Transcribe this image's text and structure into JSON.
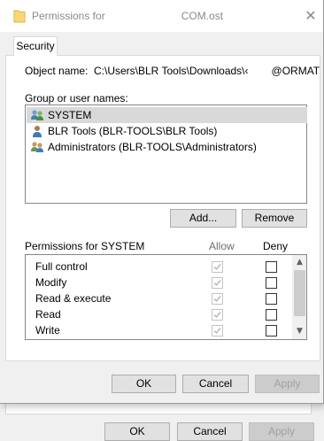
{
  "window": {
    "title_left": "Permissions for",
    "title_right": "COM.ost",
    "close_glyph": "✕"
  },
  "tab": {
    "label": "Security"
  },
  "object": {
    "label": "Object name:",
    "value_left": "C:\\Users\\BLR Tools\\Downloads\\‹",
    "value_right": "@ORMAT"
  },
  "group": {
    "label": "Group or user names:",
    "users": [
      {
        "label": "SYSTEM",
        "selected": true,
        "icon": "users-group-icon"
      },
      {
        "label": "BLR Tools (BLR-TOOLS\\BLR Tools)",
        "selected": false,
        "icon": "user-icon"
      },
      {
        "label": "Administrators (BLR-TOOLS\\Administrators)",
        "selected": false,
        "icon": "users-group-icon"
      }
    ],
    "add_label": "Add...",
    "remove_label": "Remove"
  },
  "permissions": {
    "header": "Permissions for SYSTEM",
    "allow_header": "Allow",
    "deny_header": "Deny",
    "rows": [
      {
        "name": "Full control",
        "allow": true,
        "deny": false
      },
      {
        "name": "Modify",
        "allow": true,
        "deny": false
      },
      {
        "name": "Read & execute",
        "allow": true,
        "deny": false
      },
      {
        "name": "Read",
        "allow": true,
        "deny": false
      },
      {
        "name": "Write",
        "allow": true,
        "deny": false
      }
    ]
  },
  "footer": {
    "ok_label": "OK",
    "cancel_label": "Cancel",
    "apply_label": "Apply"
  },
  "background_footer": {
    "ok_label": "OK",
    "cancel_label": "Cancel",
    "apply_label": "Apply"
  },
  "colors": {
    "selection": "#d9d9d9",
    "button_face": "#e1e1e1",
    "disabled_text": "#a0a0a0",
    "folder": "#f8d775"
  }
}
